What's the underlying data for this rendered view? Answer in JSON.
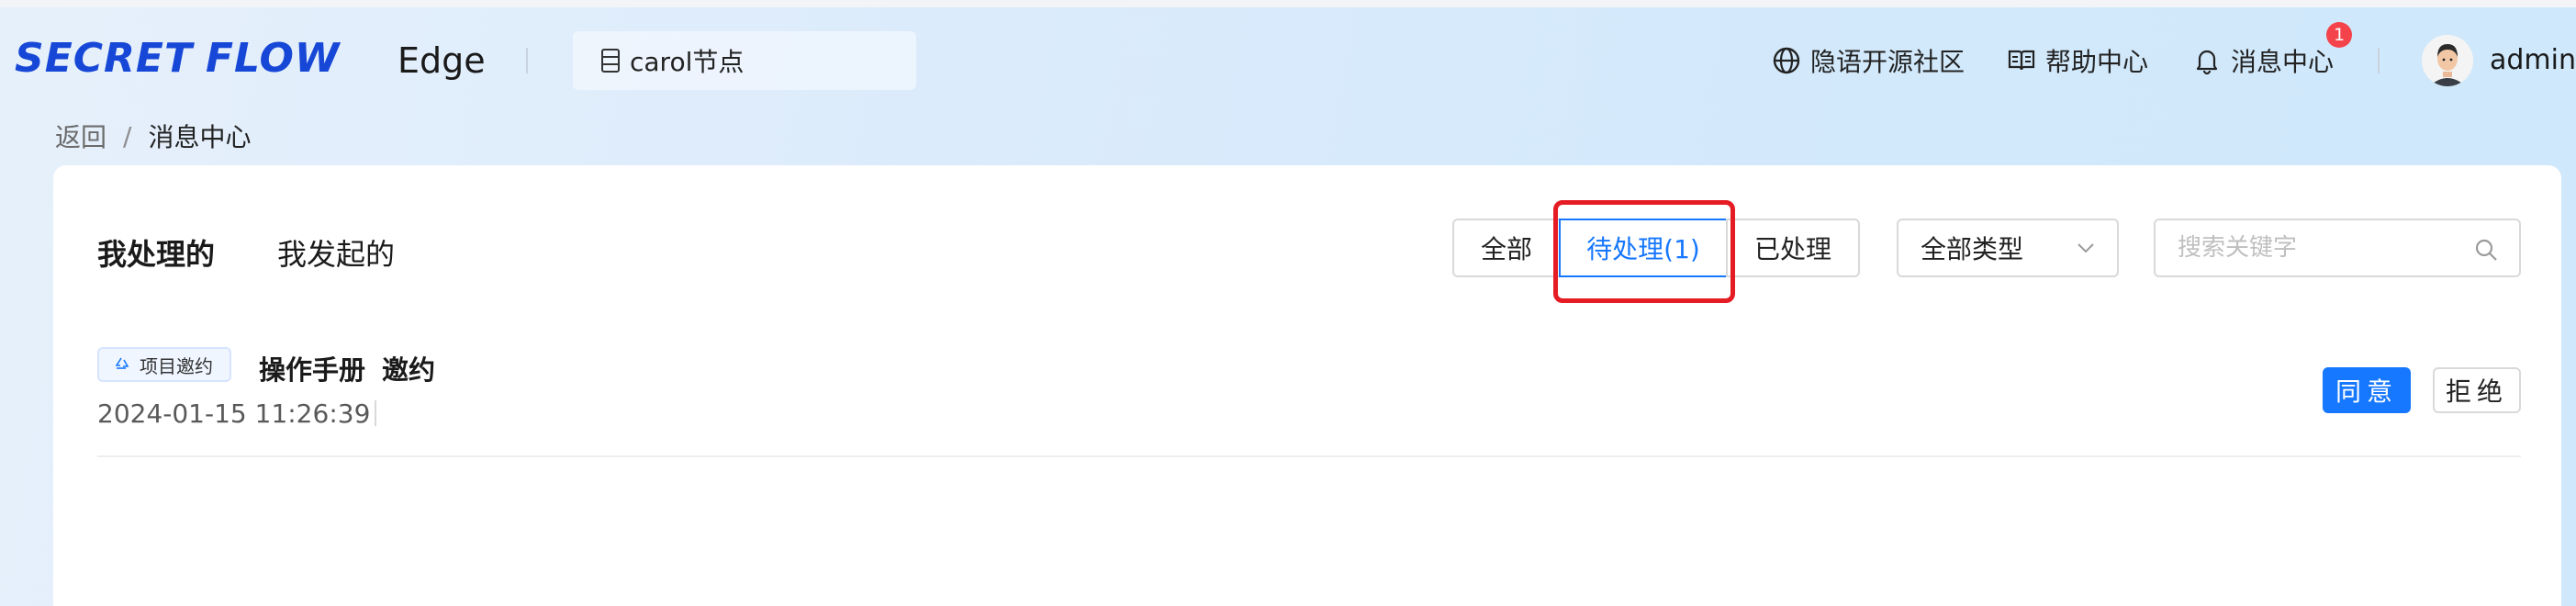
{
  "header": {
    "logo_left": "SECRET",
    "logo_right": "FLOW",
    "app_title": "Edge",
    "node_label": "carol节点",
    "nav": {
      "community": "隐语开源社区",
      "help": "帮助中心",
      "messages": "消息中心",
      "messages_badge": "1"
    },
    "user": "admin"
  },
  "breadcrumb": {
    "back": "返回",
    "separator": "/",
    "current": "消息中心"
  },
  "tabs": {
    "mine": "我处理的",
    "initiated": "我发起的"
  },
  "filters": {
    "all": "全部",
    "pending": "待处理(1)",
    "processed": "已处理"
  },
  "type_select": {
    "value": "全部类型"
  },
  "search": {
    "placeholder": "搜索关键字"
  },
  "messages": [
    {
      "tag": "项目邀约",
      "title_a": "操作手册",
      "title_b": "邀约",
      "time": "2024-01-15 11:26:39",
      "agree": "同意",
      "reject": "拒绝"
    }
  ],
  "colors": {
    "brand": "#1747d6",
    "primary": "#1677ff",
    "badge": "#f5434b",
    "highlight": "#e51c23"
  }
}
